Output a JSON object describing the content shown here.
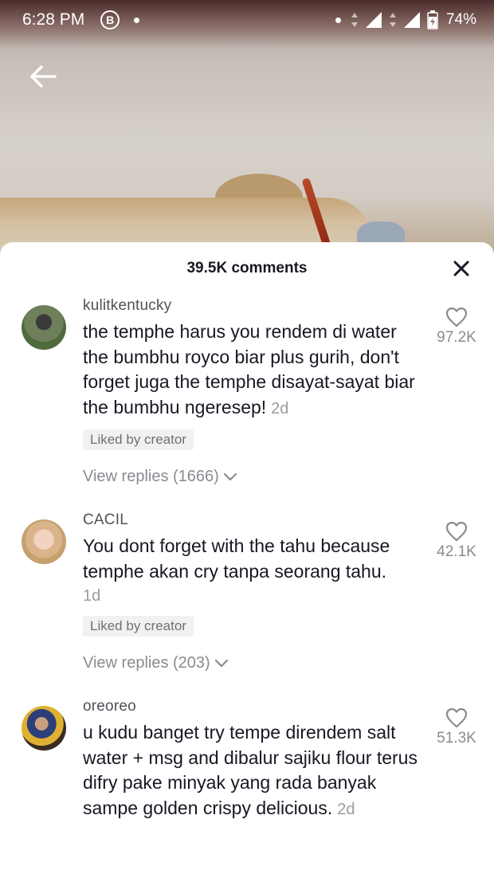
{
  "status_bar": {
    "time": "6:28 PM",
    "b_label": "B",
    "battery": "74%"
  },
  "comments_header": {
    "title": "39.5K comments"
  },
  "comments": [
    {
      "username": "kulitkentucky",
      "text": "the temphe harus you rendem di water the bumbhu royco biar plus gurih, don't forget juga the temphe disayat-sayat biar the bumbhu ngeresep!",
      "time": "2d",
      "liked_by_creator": "Liked by creator",
      "view_replies": "View replies (1666)",
      "likes": "97.2K"
    },
    {
      "username": "CACIL",
      "text": "You dont forget with the tahu because temphe akan cry tanpa seorang tahu.",
      "time": "1d",
      "liked_by_creator": "Liked by creator",
      "view_replies": "View replies (203)",
      "likes": "42.1K"
    },
    {
      "username": "oreoreo",
      "text": "u kudu banget try tempe direndem salt water + msg and dibalur sajiku flour terus difry pake minyak yang rada banyak sampe golden crispy delicious.",
      "time": "2d",
      "likes": "51.3K"
    }
  ],
  "icons": {
    "back": "arrow-left-icon",
    "close": "close-icon",
    "like": "heart-outline-icon",
    "expand": "chevron-down-icon"
  }
}
